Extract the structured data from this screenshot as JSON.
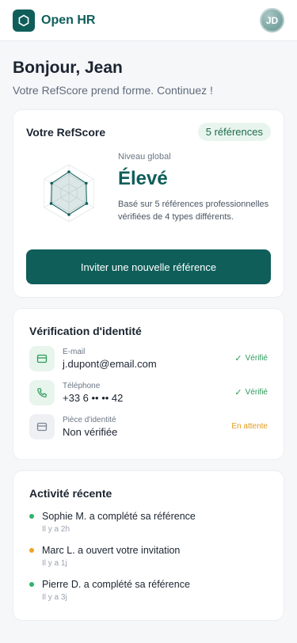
{
  "header": {
    "brand": "Open HR",
    "avatar_initials": "JD",
    "logo_icon": "hexagon-icon"
  },
  "greeting": {
    "title": "Bonjour, Jean",
    "subtitle": "Votre RefScore prend forme. Continuez !"
  },
  "refscore": {
    "title": "Votre RefScore",
    "badge": "5 références",
    "level_label": "Niveau global",
    "level": "Élevé",
    "description": "Basé sur 5 références professionnelles vérifiées de 4 types différents.",
    "invite_button": "Inviter une nouvelle référence",
    "radar_values": [
      0.75,
      0.7,
      0.72,
      0.75,
      0.72,
      0.7
    ]
  },
  "identity": {
    "title": "Vérification d'identité",
    "rows": [
      {
        "label": "E-mail",
        "value": "j.dupont@email.com",
        "status": "Vérifié",
        "state": "ok",
        "icon": "email-icon"
      },
      {
        "label": "Téléphone",
        "value": "+33 6 •• •• 42",
        "status": "Vérifié",
        "state": "ok",
        "icon": "phone-icon"
      },
      {
        "label": "Pièce d'identité",
        "value": "Non vérifiée",
        "status": "En attente",
        "state": "pending",
        "icon": "id-card-icon"
      }
    ]
  },
  "activity": {
    "title": "Activité récente",
    "items": [
      {
        "text": "Sophie M. a complété sa référence",
        "time": "Il y a 2h",
        "color": "#2fb36b"
      },
      {
        "text": "Marc L. a ouvert votre invitation",
        "time": "Il y a 1j",
        "color": "#f0a128"
      },
      {
        "text": "Pierre D. a complété sa référence",
        "time": "Il y a 3j",
        "color": "#2fb36b"
      }
    ]
  },
  "colors": {
    "primary": "#0f5e5a",
    "verified": "#2e9a5c",
    "pending": "#e39a1a"
  }
}
